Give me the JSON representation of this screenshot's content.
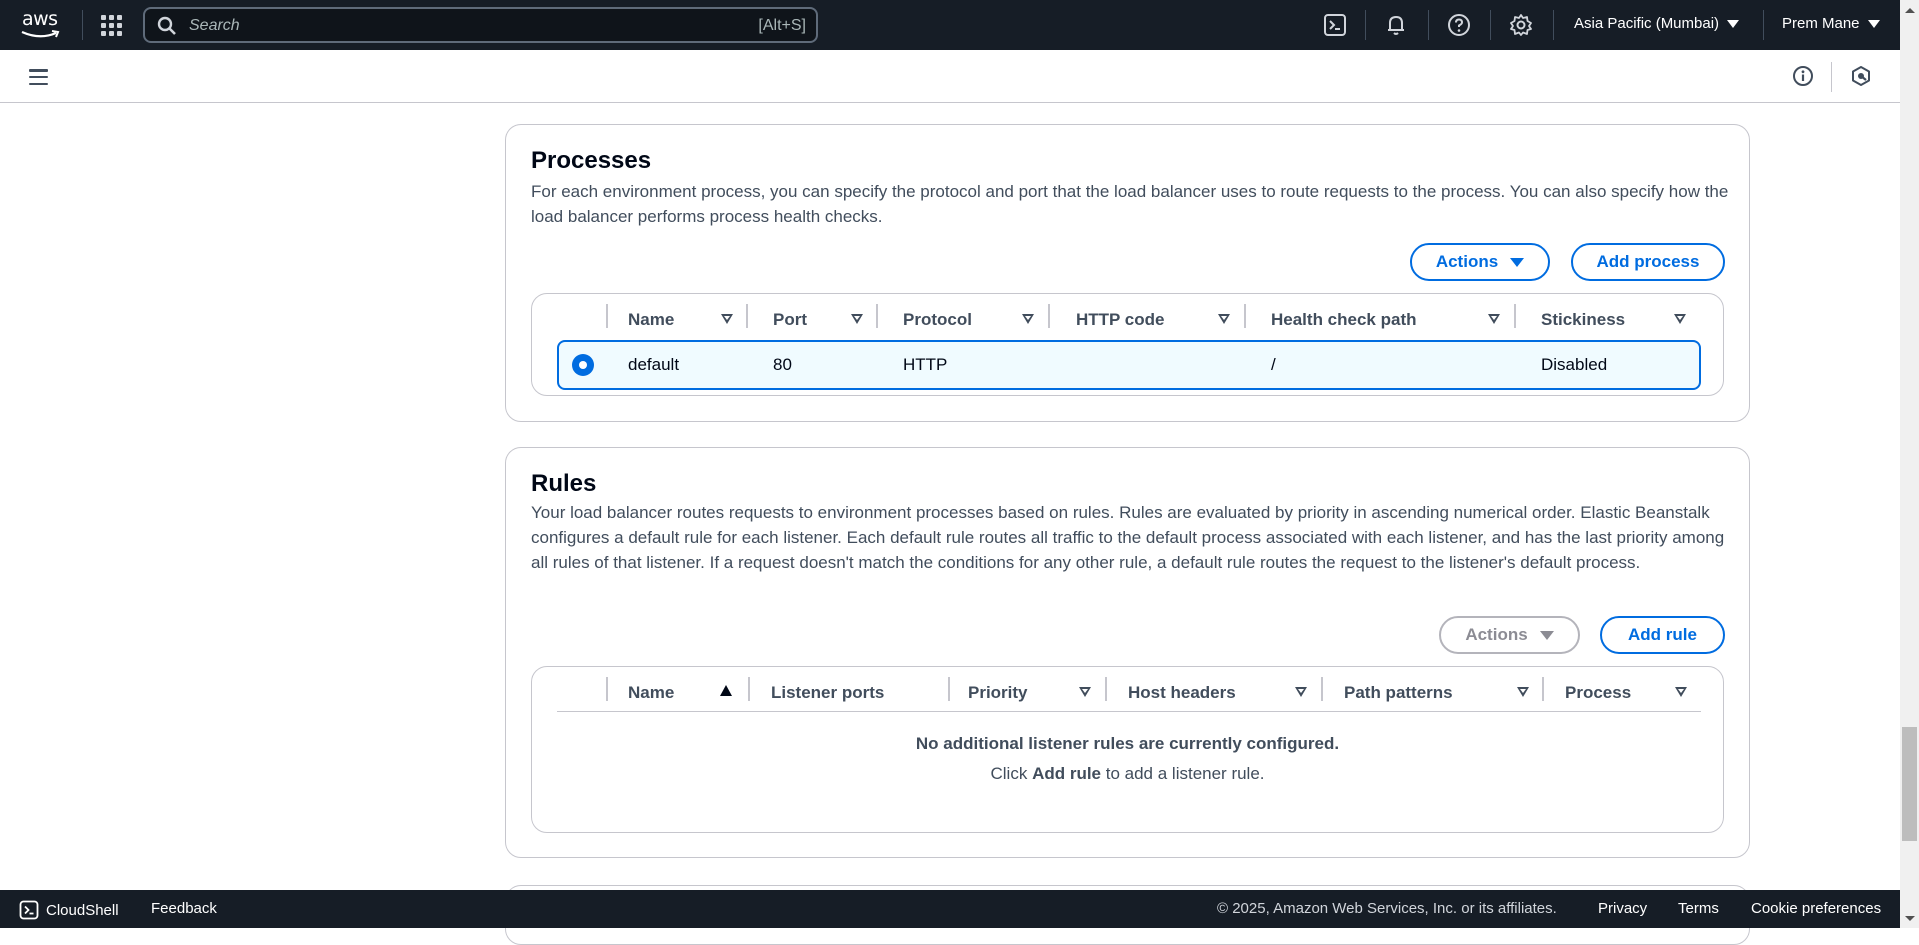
{
  "topnav": {
    "logo": "aws",
    "search_placeholder": "Search",
    "search_shortcut": "[Alt+S]",
    "icons": [
      "cloudshell-icon",
      "bell-icon",
      "help-icon",
      "settings-icon"
    ],
    "region": "Asia Pacific (Mumbai)",
    "user": "Prem Mane"
  },
  "subheader": {
    "icons": [
      "menu-icon",
      "info-icon",
      "notifications-panel-icon"
    ]
  },
  "processes": {
    "title": "Processes",
    "description": "For each environment process, you can specify the protocol and port that the load balancer uses to route requests to the process. You can also specify how the load balancer performs process health checks.",
    "actions_label": "Actions",
    "add_label": "Add process",
    "columns": [
      "Name",
      "Port",
      "Protocol",
      "HTTP code",
      "Health check path",
      "Stickiness"
    ],
    "rows": [
      {
        "selected": true,
        "name": "default",
        "port": "80",
        "protocol": "HTTP",
        "http_code": "",
        "health_check_path": "/",
        "stickiness": "Disabled"
      }
    ]
  },
  "rules": {
    "title": "Rules",
    "description": "Your load balancer routes requests to environment processes based on rules. Rules are evaluated by priority in ascending numerical order. Elastic Beanstalk configures a default rule for each listener. Each default rule routes all traffic to the default process associated with each listener, and has the last priority among all rules of that listener. If a request doesn't match the conditions for any other rule, a default rule routes the request to the listener's default process.",
    "actions_label": "Actions",
    "add_label": "Add rule",
    "columns": [
      "Name",
      "Listener ports",
      "Priority",
      "Host headers",
      "Path patterns",
      "Process"
    ],
    "sorted_column": "Name",
    "sort_direction": "ascending",
    "empty_title": "No additional listener rules are currently configured.",
    "empty_prefix": "Click",
    "empty_link": "Add rule",
    "empty_suffix": "to add a listener rule."
  },
  "footer": {
    "cloudshell": "CloudShell",
    "feedback": "Feedback",
    "copyright": "© 2025, Amazon Web Services, Inc. or its affiliates.",
    "privacy": "Privacy",
    "terms": "Terms",
    "cookie": "Cookie preferences"
  },
  "colors": {
    "accent": "#006ce0",
    "nav_bg": "#161d26",
    "selected_row_bg": "#f0fbff"
  }
}
